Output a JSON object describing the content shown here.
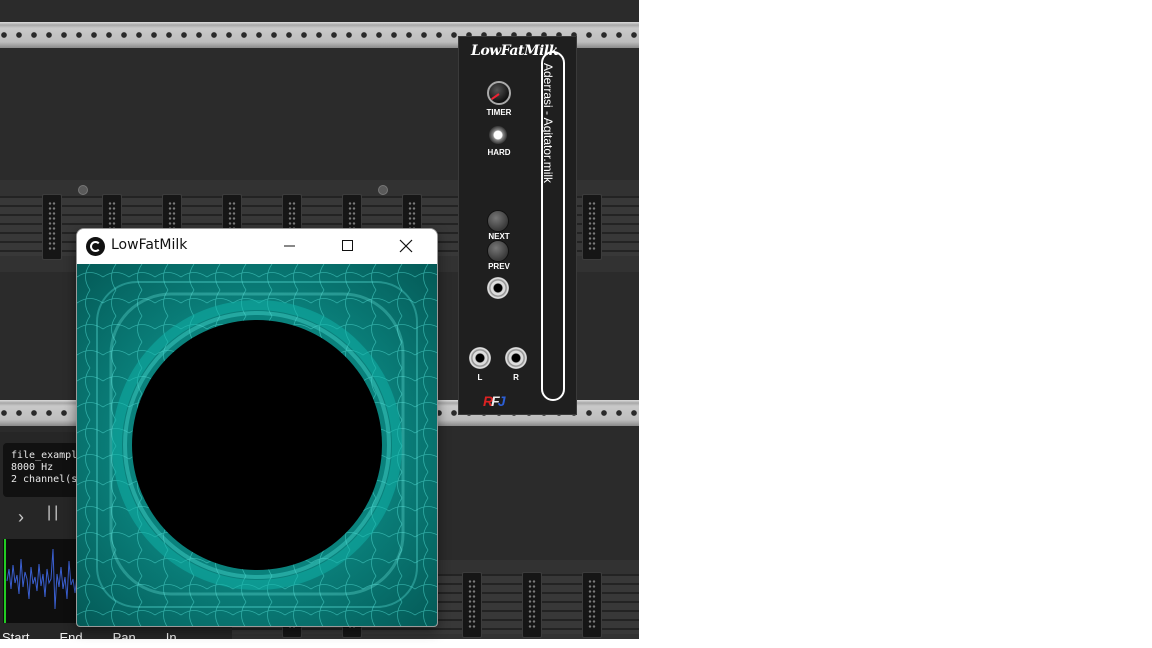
{
  "window": {
    "title": "LowFatMilk",
    "minimize_icon": "minimize-icon",
    "maximize_icon": "maximize-icon",
    "close_icon": "close-icon"
  },
  "panel": {
    "brand": "LowFatMilk",
    "knob_label": "TIMER",
    "hard_label": "HARD",
    "next_label": "NEXT",
    "prev_label": "PREV",
    "left_label": "L",
    "right_label": "R",
    "preset_title": "Aderrasi - Agitator.milk",
    "logo_text": "RFJ"
  },
  "wav_player": {
    "info_lines": [
      "file_exampl",
      "8000 Hz",
      "2 channel(s"
    ],
    "play_icon": "play-icon",
    "pause_icon": "pause-icon",
    "labels": [
      "Start",
      "End",
      "Pan",
      "In"
    ]
  },
  "colors": {
    "rack_bg": "#2b2b2b",
    "panel_bg": "#1f1f1f",
    "viz_teal": "#0b7f7a",
    "waveform": "#3a5fd0",
    "playhead": "#22cc22"
  }
}
